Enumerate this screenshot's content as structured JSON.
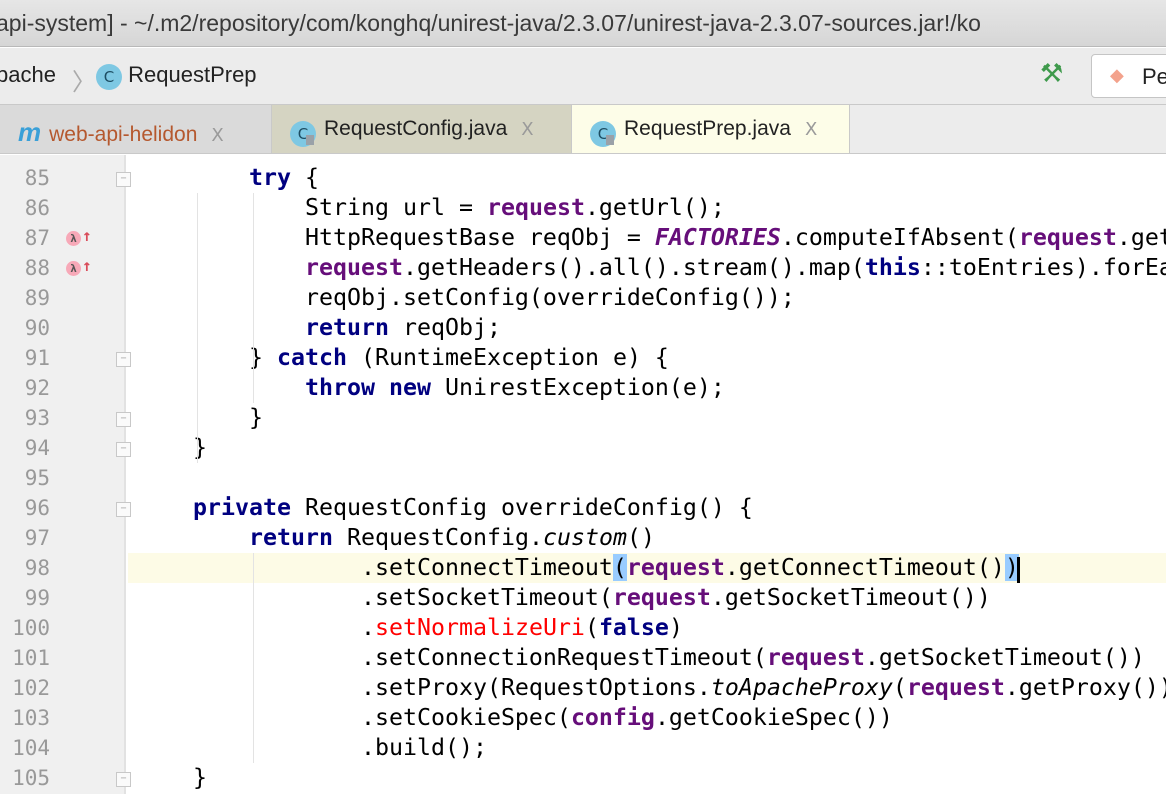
{
  "title_bar": {
    "text": "api-system] - ~/.m2/repository/com/konghq/unirest-java/2.3.07/unirest-java-2.3.07-sources.jar!/ko"
  },
  "nav_bar": {
    "breadcrumbs": [
      {
        "label": "pache"
      },
      {
        "label": "RequestPrep",
        "icon": "C"
      }
    ],
    "run_config_label": "Pe"
  },
  "tabs": [
    {
      "label": "web-api-helidon",
      "icon": "m",
      "close": "X"
    },
    {
      "label": "RequestConfig.java",
      "icon": "C",
      "close": "X"
    },
    {
      "label": "RequestPrep.java",
      "icon": "C",
      "close": "X",
      "active": true
    }
  ],
  "colors": {
    "keyword": "#000080",
    "field": "#660e7a",
    "error": "#ff0000",
    "current_line": "#fdfbe6",
    "brace_match": "#99ccff"
  },
  "code": {
    "current_line": 98,
    "lines": [
      {
        "n": "85",
        "fold": "open",
        "tokens": [
          {
            "t": "        "
          },
          {
            "t": "try",
            "s": "k"
          },
          {
            "t": " {"
          }
        ]
      },
      {
        "n": "86",
        "tokens": [
          {
            "t": "            String url = "
          },
          {
            "t": "request",
            "s": "f"
          },
          {
            "t": ".getUrl();"
          }
        ]
      },
      {
        "n": "87",
        "lambda": true,
        "tokens": [
          {
            "t": "            HttpRequestBase reqObj = "
          },
          {
            "t": "FACTORIES",
            "s": "fi"
          },
          {
            "t": ".computeIfAbsent("
          },
          {
            "t": "request",
            "s": "f"
          },
          {
            "t": ".get"
          }
        ]
      },
      {
        "n": "88",
        "lambda": true,
        "tokens": [
          {
            "t": "            "
          },
          {
            "t": "request",
            "s": "f"
          },
          {
            "t": ".getHeaders().all().stream().map("
          },
          {
            "t": "this",
            "s": "k"
          },
          {
            "t": "::toEntries).forEa"
          }
        ]
      },
      {
        "n": "89",
        "tokens": [
          {
            "t": "            reqObj.setConfig(overrideConfig());"
          }
        ]
      },
      {
        "n": "90",
        "tokens": [
          {
            "t": "            "
          },
          {
            "t": "return",
            "s": "k"
          },
          {
            "t": " reqObj;"
          }
        ]
      },
      {
        "n": "91",
        "fold": "open",
        "tokens": [
          {
            "t": "        } "
          },
          {
            "t": "catch",
            "s": "k"
          },
          {
            "t": " (RuntimeException e) {"
          }
        ]
      },
      {
        "n": "92",
        "tokens": [
          {
            "t": "            "
          },
          {
            "t": "throw new",
            "s": "k"
          },
          {
            "t": " UnirestException(e);"
          }
        ]
      },
      {
        "n": "93",
        "fold": "close",
        "tokens": [
          {
            "t": "        }"
          }
        ]
      },
      {
        "n": "94",
        "fold": "close",
        "tokens": [
          {
            "t": "    }"
          }
        ]
      },
      {
        "n": "95",
        "tokens": []
      },
      {
        "n": "96",
        "fold": "open",
        "tokens": [
          {
            "t": "    "
          },
          {
            "t": "private",
            "s": "k"
          },
          {
            "t": " RequestConfig overrideConfig() {"
          }
        ]
      },
      {
        "n": "97",
        "tokens": [
          {
            "t": "        "
          },
          {
            "t": "return",
            "s": "k"
          },
          {
            "t": " RequestConfig."
          },
          {
            "t": "custom",
            "s": "i"
          },
          {
            "t": "()"
          }
        ]
      },
      {
        "n": "98",
        "tokens": [
          {
            "t": "                .setConnectTimeout"
          },
          {
            "t": "(",
            "s": "bm"
          },
          {
            "t": "request",
            "s": "f"
          },
          {
            "t": ".getConnectTimeout()"
          },
          {
            "t": ")",
            "s": "bm"
          }
        ]
      },
      {
        "n": "99",
        "tokens": [
          {
            "t": "                .setSocketTimeout("
          },
          {
            "t": "request",
            "s": "f"
          },
          {
            "t": ".getSocketTimeout())"
          }
        ]
      },
      {
        "n": "100",
        "tokens": [
          {
            "t": "                ."
          },
          {
            "t": "setNormalizeUri",
            "s": "r"
          },
          {
            "t": "("
          },
          {
            "t": "false",
            "s": "k"
          },
          {
            "t": ")"
          }
        ]
      },
      {
        "n": "101",
        "tokens": [
          {
            "t": "                .setConnectionRequestTimeout("
          },
          {
            "t": "request",
            "s": "f"
          },
          {
            "t": ".getSocketTimeout())"
          }
        ]
      },
      {
        "n": "102",
        "tokens": [
          {
            "t": "                .setProxy(RequestOptions."
          },
          {
            "t": "toApacheProxy",
            "s": "i"
          },
          {
            "t": "("
          },
          {
            "t": "request",
            "s": "f"
          },
          {
            "t": ".getProxy())"
          }
        ]
      },
      {
        "n": "103",
        "tokens": [
          {
            "t": "                .setCookieSpec("
          },
          {
            "t": "config",
            "s": "f"
          },
          {
            "t": ".getCookieSpec())"
          }
        ]
      },
      {
        "n": "104",
        "tokens": [
          {
            "t": "                .build();"
          }
        ]
      },
      {
        "n": "105",
        "fold": "close",
        "tokens": [
          {
            "t": "    }"
          }
        ]
      }
    ]
  }
}
